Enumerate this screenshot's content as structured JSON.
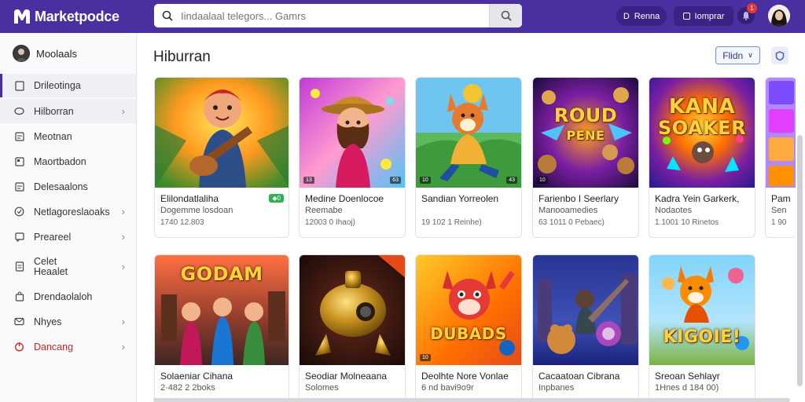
{
  "app": {
    "title": "Marketpodce"
  },
  "search": {
    "placeholder": "Iindaalaal telegors... Gamrs"
  },
  "header": {
    "pill1": "Renna",
    "pill2": "Iomprar",
    "notification_count": "1"
  },
  "sidebar": {
    "profile_name": "Moolaals",
    "items": [
      {
        "label": "Drileotinga",
        "icon": "page-icon",
        "active": true,
        "chevron": false
      },
      {
        "label": "Hilborran",
        "icon": "circle-icon",
        "active": false,
        "chevron": true
      },
      {
        "label": "Meotnan",
        "icon": "list-icon",
        "active": false,
        "chevron": false
      },
      {
        "label": "Maortbadon",
        "icon": "image-icon",
        "active": false,
        "chevron": false
      },
      {
        "label": "Delesaalons",
        "icon": "list-icon",
        "active": false,
        "chevron": false
      },
      {
        "label": "Netlagoreslaoaks",
        "icon": "check-circle-icon",
        "active": false,
        "chevron": true
      },
      {
        "label": "Preareel",
        "icon": "chat-icon",
        "active": false,
        "chevron": true
      },
      {
        "label": "Celet\nHeaalet",
        "icon": "doc-icon",
        "active": false,
        "chevron": true
      },
      {
        "label": "Drendaolaloh",
        "icon": "bag-icon",
        "active": false,
        "chevron": false
      },
      {
        "label": "Nhyes",
        "icon": "message-icon",
        "active": false,
        "chevron": true
      },
      {
        "label": "Dancang",
        "icon": "power-icon",
        "active": false,
        "chevron": true,
        "red": true
      }
    ]
  },
  "main": {
    "title": "Hiburran",
    "filter_label": "Flidn"
  },
  "cards": [
    {
      "title": "Elilondatlaliha",
      "sub": "Dogemme losdoan",
      "meta": "1740 12.803",
      "price": "◆0",
      "art_text": "",
      "badge_l": "",
      "badge_r": ""
    },
    {
      "title": "Medine Doenlocoe",
      "sub": "Reemabe",
      "meta": "12003 0 Ihaoj)",
      "price": "",
      "art_text": "",
      "badge_l": "13",
      "badge_r": "63"
    },
    {
      "title": "Sandian Yorreolen",
      "sub": "",
      "meta": "19 102 1 Reinhe)",
      "price": "",
      "art_text": "",
      "badge_l": "10",
      "badge_r": "43"
    },
    {
      "title": "Farienbo I Seerlary",
      "sub": "Manooamedies",
      "meta": "63 1011 0 Pebaec)",
      "price": "",
      "art_text": "ROUD",
      "art_sub": "PENE",
      "badge_l": "10",
      "badge_r": ""
    },
    {
      "title": "Kadra Yein Garkerk,",
      "sub": "Nodaotes",
      "meta": "1.1001 10 Rinetos",
      "price": "",
      "art_text": "KANA",
      "art_sub": "SOAKER",
      "badge_l": "",
      "badge_r": ""
    },
    {
      "title": "Pam",
      "sub": "Sen",
      "meta": "1 90",
      "price": "",
      "art_text": "",
      "badge_l": "",
      "badge_r": ""
    },
    {
      "title": "Solaeniar Cihana",
      "sub": "2·482 2 2boks",
      "meta": "",
      "price": "",
      "art_text": "GODAM",
      "badge_l": "",
      "badge_r": ""
    },
    {
      "title": "Seodiar Molneaana",
      "sub": "Solomes",
      "meta": "",
      "price": "",
      "art_text": "",
      "badge_l": "",
      "badge_r": ""
    },
    {
      "title": "Deolhte Nore Vonlae",
      "sub": "6 nd bavi9o9r",
      "meta": "",
      "price": "",
      "art_text": "DUBADS",
      "badge_l": "10",
      "badge_r": ""
    },
    {
      "title": "Cacaatoan Cibrana",
      "sub": "Inpbanes",
      "meta": "",
      "price": "",
      "art_text": "",
      "badge_l": "",
      "badge_r": ""
    },
    {
      "title": "Sreoan Sehlayr",
      "sub": "1Hnes d 184 00)",
      "meta": "",
      "price": "",
      "art_text": "KIGOIE!",
      "badge_l": "",
      "badge_r": ""
    }
  ],
  "colors": {
    "brand": "#4a2fa0",
    "accent": "#2fae54",
    "danger": "#c62828"
  }
}
